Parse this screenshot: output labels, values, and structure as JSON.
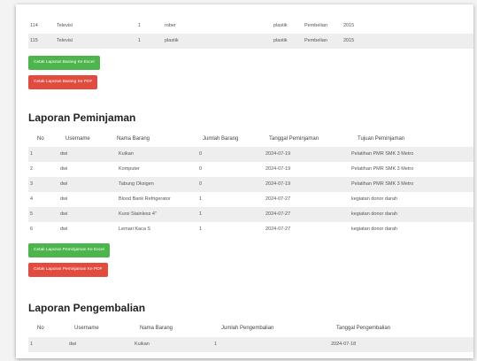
{
  "top_rows": [
    {
      "no": "114",
      "nama": "Televisi",
      "jml": "1",
      "kondisi": "rober",
      "bahan": "plastik",
      "asal": "Pembelian",
      "tahun": "2015"
    },
    {
      "no": "115",
      "nama": "Televisi",
      "jml": "1",
      "kondisi": "plastik",
      "bahan": "plastik",
      "asal": "Pembelian",
      "tahun": "2015"
    }
  ],
  "barang": {
    "excel_label": "Cetak Laporan Barang Ke Excel",
    "pdf_label": "Cetak Laporan Barang Ke PDF"
  },
  "peminjaman": {
    "title": "Laporan Peminjaman",
    "headers": {
      "no": "No",
      "username": "Username",
      "nama": "Nama Barang",
      "jumlah": "Jumlah Barang",
      "tanggal": "Tanggal Peminjaman",
      "tujuan": "Tujuan Peminjaman"
    },
    "rows": [
      {
        "no": "1",
        "username": "dwi",
        "nama": "Kuikan",
        "jumlah": "0",
        "tanggal": "2024-07-19",
        "tujuan": "Pelatihan PMR SMK 3 Metro"
      },
      {
        "no": "2",
        "username": "dwi",
        "nama": "Komputer",
        "jumlah": "0",
        "tanggal": "2024-07-19",
        "tujuan": "Pelatihan PMR SMK 3 Metro"
      },
      {
        "no": "3",
        "username": "dwi",
        "nama": "Tabung Oksigen",
        "jumlah": "0",
        "tanggal": "2024-07-19",
        "tujuan": "Pelatihan PMR SMK 3 Metro"
      },
      {
        "no": "4",
        "username": "dwi",
        "nama": "Blood Bank Refrigerator",
        "jumlah": "1",
        "tanggal": "2024-07-27",
        "tujuan": "kegiatan donor darah"
      },
      {
        "no": "5",
        "username": "dwi",
        "nama": "Kursi Stainless 4\"",
        "jumlah": "1",
        "tanggal": "2024-07-27",
        "tujuan": "kegiatan donor darah"
      },
      {
        "no": "6",
        "username": "dwi",
        "nama": "Lemari Kaca S",
        "jumlah": "1",
        "tanggal": "2024-07-27",
        "tujuan": "kegiatan donor darah"
      }
    ],
    "excel_label": "Cetak Laporan Peminjaman Ke Excel",
    "pdf_label": "Cetak Laporan Peminjaman Ke PDF"
  },
  "pengembalian": {
    "title": "Laporan Pengembalian",
    "headers": {
      "no": "No",
      "username": "Username",
      "nama": "Nama Barang",
      "jumlah": "Jumlah Pengembalian",
      "tanggal": "Tanggal Pengembalian"
    },
    "rows": [
      {
        "no": "1",
        "username": "dwi",
        "nama": "Kuikan",
        "jumlah": "1",
        "tanggal": "2024-07-18"
      }
    ]
  },
  "colors": {
    "green": "#4cb64c",
    "red": "#e24c3f",
    "stripe": "#eeeeee"
  }
}
